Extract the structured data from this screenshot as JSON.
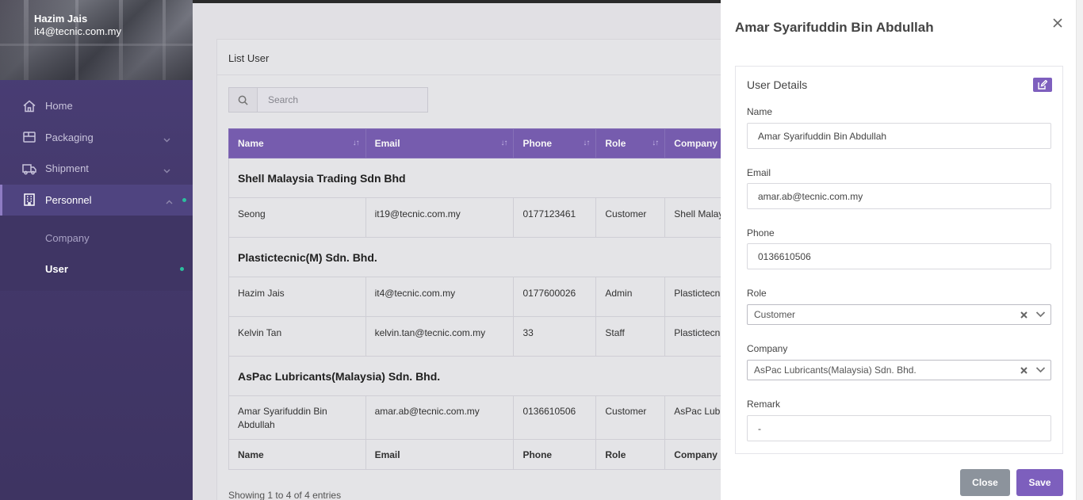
{
  "sidebar": {
    "user_name": "Hazim Jais",
    "user_email": "it4@tecnic.com.my",
    "items": [
      {
        "label": "Home",
        "icon": "home-icon"
      },
      {
        "label": "Packaging",
        "icon": "box-icon"
      },
      {
        "label": "Shipment",
        "icon": "truck-icon"
      },
      {
        "label": "Personnel",
        "icon": "building-icon"
      }
    ],
    "subitems": [
      {
        "label": "Company"
      },
      {
        "label": "User"
      }
    ],
    "accent_dot_color": "#2bbf9e"
  },
  "list": {
    "title": "List User",
    "search_placeholder": "Search",
    "columns": [
      "Name",
      "Email",
      "Phone",
      "Role",
      "Company"
    ],
    "groups": [
      {
        "company": "Shell Malaysia Trading Sdn Bhd",
        "rows": [
          {
            "name": "Seong",
            "email": "it19@tecnic.com.my",
            "phone": "0177123461",
            "role": "Customer",
            "company": "Shell Malay"
          }
        ]
      },
      {
        "company": "Plastictecnic(M) Sdn. Bhd.",
        "rows": [
          {
            "name": "Hazim Jais",
            "email": "it4@tecnic.com.my",
            "phone": "0177600026",
            "role": "Admin",
            "company": "Plastictecn"
          },
          {
            "name": "Kelvin Tan",
            "email": "kelvin.tan@tecnic.com.my",
            "phone": "33",
            "role": "Staff",
            "company": "Plastictecn"
          }
        ]
      },
      {
        "company": "AsPac Lubricants(Malaysia) Sdn. Bhd.",
        "rows": [
          {
            "name": "Amar Syarifuddin Bin Abdullah",
            "email": "amar.ab@tecnic.com.my",
            "phone": "0136610506",
            "role": "Customer",
            "company": "AsPac Lubr"
          }
        ]
      }
    ],
    "footer_columns": [
      "Name",
      "Email",
      "Phone",
      "Role",
      "Company"
    ],
    "showing": "Showing 1 to 4 of 4 entries",
    "header_color": "#7a5fb4"
  },
  "panel": {
    "title": "Amar Syarifuddin Bin Abdullah",
    "section_title": "User Details",
    "fields": {
      "name_label": "Name",
      "name_value": "Amar Syarifuddin Bin Abdullah",
      "email_label": "Email",
      "email_value": "amar.ab@tecnic.com.my",
      "phone_label": "Phone",
      "phone_value": "0136610506",
      "role_label": "Role",
      "role_value": "Customer",
      "company_label": "Company",
      "company_value": "AsPac Lubricants(Malaysia) Sdn. Bhd.",
      "remark_label": "Remark",
      "remark_value": "-"
    },
    "close_label": "Close",
    "save_label": "Save",
    "save_color": "#7d5fbd",
    "close_color": "#8c939c"
  }
}
